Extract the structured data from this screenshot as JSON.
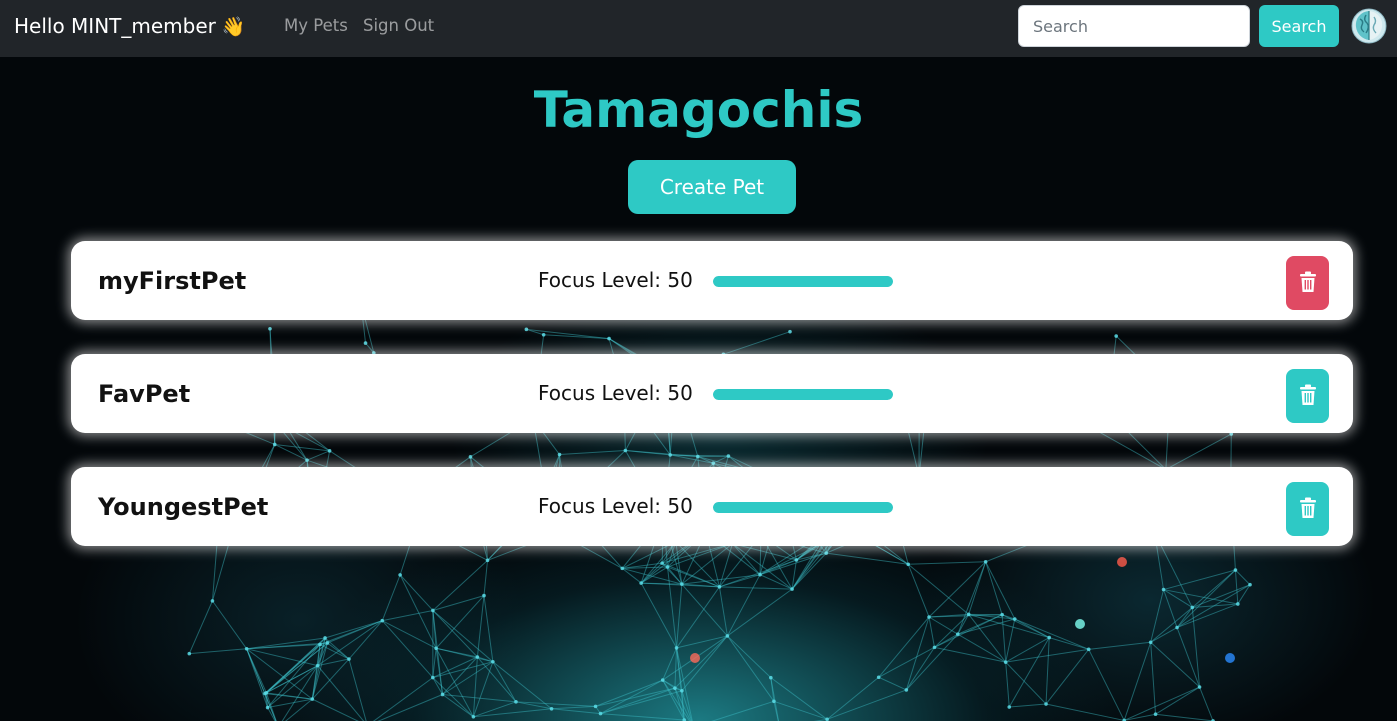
{
  "navbar": {
    "greeting": "Hello MINT_member",
    "greeting_emoji": "👋",
    "links": [
      "My Pets",
      "Sign Out"
    ],
    "search_placeholder": "Search",
    "search_button": "Search",
    "logo_icon": "brain-icon"
  },
  "main": {
    "title": "Tamagochis",
    "create_button": "Create Pet",
    "focus_label_prefix": "Focus Level:",
    "pets": [
      {
        "name": "myFirstPet",
        "focus_level": 50,
        "focus_text": "Focus Level: 50",
        "delete_icon": "trash-icon",
        "delete_color": "#e04a63"
      },
      {
        "name": "FavPet",
        "focus_level": 50,
        "focus_text": "Focus Level: 50",
        "delete_icon": "trash-icon",
        "delete_color": "#2ec9c5"
      },
      {
        "name": "YoungestPet",
        "focus_level": 50,
        "focus_text": "Focus Level: 50",
        "delete_icon": "trash-icon",
        "delete_color": "#2ec9c5"
      }
    ]
  },
  "colors": {
    "accent": "#2ec9c5",
    "navbar_bg": "#212529",
    "danger": "#e04a63"
  }
}
